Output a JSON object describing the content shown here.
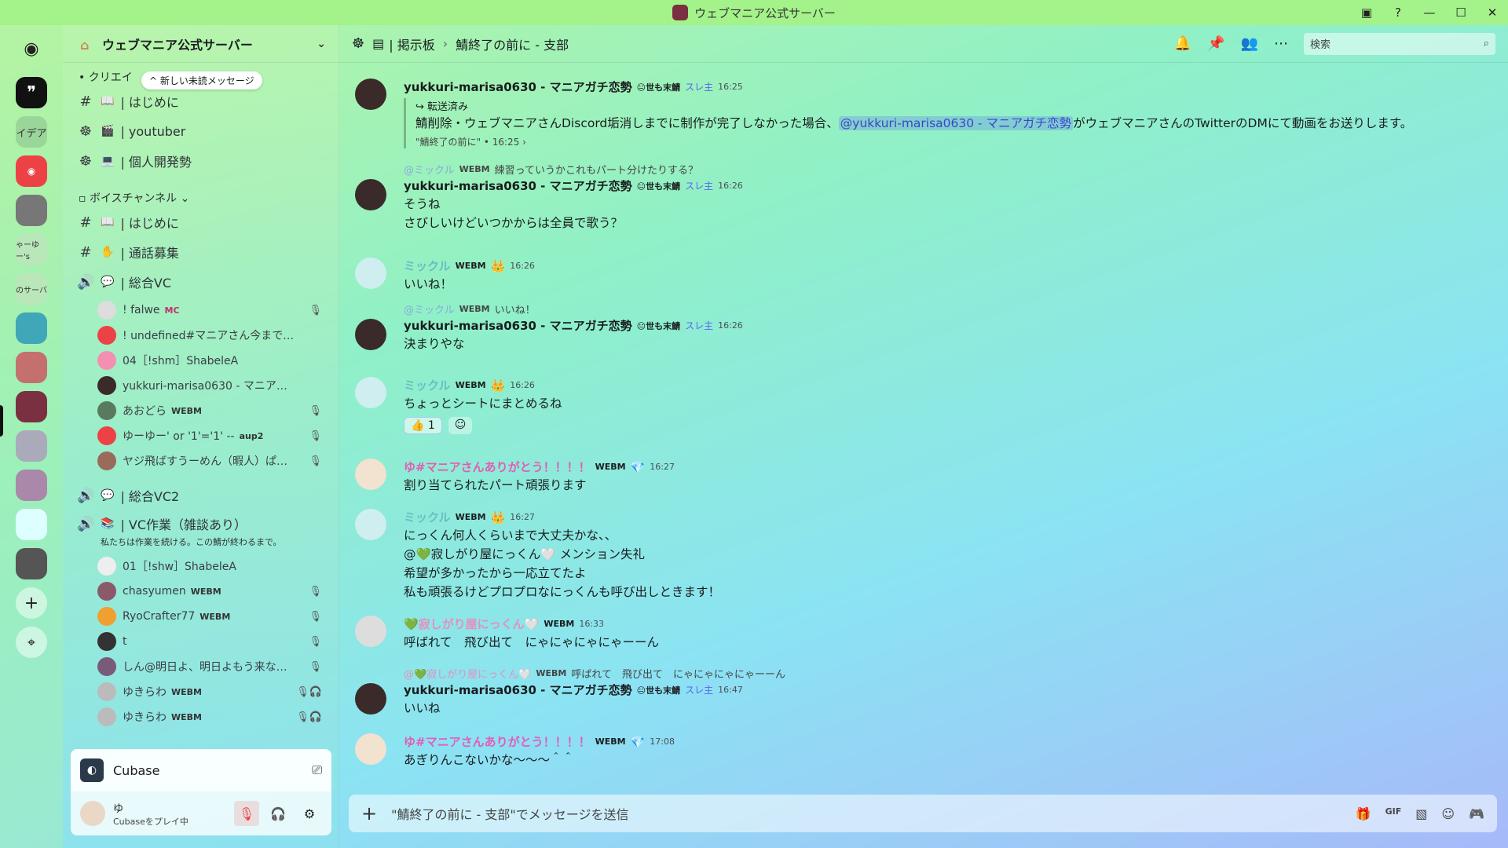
{
  "window": {
    "title": "ウェブマニア公式サーバー"
  },
  "rail": {
    "items": [
      "💬",
      "イデア",
      "Discord",
      "",
      "ゃーゆー's",
      "のサーバ",
      "",
      "",
      "",
      "",
      "",
      "",
      "",
      "+",
      "⌖"
    ]
  },
  "sidebar": {
    "guild_name": "ウェブマニア公式サーバー",
    "unread_pill": "新しい未読メッセージ",
    "category1": "クリエイ",
    "channels_top": [
      {
        "icon": "#",
        "emoji": "📖",
        "label": "| はじめに"
      },
      {
        "icon": "☸",
        "emoji": "🎬",
        "label": "| youtuber"
      },
      {
        "icon": "☸",
        "emoji": "💻",
        "label": "| 個人開発勢"
      }
    ],
    "voice_category": "ボイスチャンネル",
    "channels_voice": [
      {
        "icon": "#",
        "emoji": "📖",
        "label": "| はじめに"
      },
      {
        "icon": "#",
        "emoji": "✋",
        "label": "| 通話募集"
      },
      {
        "icon": "🔊",
        "emoji": "💬",
        "label": "| 総合VC"
      }
    ],
    "vc1_users": [
      {
        "name": "! falwe",
        "badge": "MC",
        "muted": "🎙",
        "color": "#ddd"
      },
      {
        "name": "! undefined#マニアさん今までありが…",
        "badge": "",
        "muted": "",
        "color": "#ed4245"
      },
      {
        "name": "04［!shm］ShabeleA",
        "badge": "",
        "muted": "",
        "color": "#f48fb1"
      },
      {
        "name": "yukkuri-marisa0630 - マニアガチ恋勢",
        "badge": "",
        "muted": "",
        "color": "#3a2a2a"
      },
      {
        "name": "あおどら",
        "badge": "WEBM",
        "muted": "🎙",
        "color": "#5a7a60"
      },
      {
        "name": "ゆーゆー' or '1'='1' --",
        "badge": "aup2",
        "muted": "🎙",
        "color": "#ed4245"
      },
      {
        "name": "ヤジ飛ばすうーめん（暇人）ぱけ…",
        "badge": "",
        "muted": "🎙",
        "color": "#9a6a5a"
      }
    ],
    "vc2": {
      "icon": "🔊",
      "emoji": "💬",
      "label": "| 総合VC2"
    },
    "vc3": {
      "icon": "🔊",
      "emoji": "📚",
      "label": "| VC作業（雑談あり）",
      "desc": "私たちは作業を続ける。この鯖が終わるまで。"
    },
    "vc3_users": [
      {
        "name": "01［!shw］ShabeleA",
        "badge": "",
        "muted": "",
        "color": "#ddd"
      },
      {
        "name": "chasyumen",
        "badge": "WEBM",
        "muted": "🎙",
        "color": "#8a5a6a"
      },
      {
        "name": "RyoCrafter77",
        "badge": "WEBM",
        "muted": "🎙",
        "color": "#f0a030"
      },
      {
        "name": "t",
        "badge": "",
        "muted": "🎙",
        "color": "#333"
      },
      {
        "name": "しん@明日よ、明日よもう来ない…",
        "badge": "",
        "muted": "🎙",
        "color": "#7a5a7a"
      },
      {
        "name": "ゆきらわ",
        "badge": "WEBM",
        "muted": "🎙🎧",
        "color": "#aaa"
      },
      {
        "name": "ゆきらわ",
        "badge": "WEBM",
        "muted": "🎙🎧",
        "color": "#aaa"
      }
    ],
    "activity": {
      "app": "Cubase"
    },
    "user": {
      "name": "ゆ",
      "status": "Cubaseをプレイ中"
    }
  },
  "header": {
    "channel": "| 掲示板",
    "thread": "鯖終了の前に - 支部",
    "search_placeholder": "検索"
  },
  "messages": [
    {
      "name": "yukkuri-marisa0630 - マニアガチ恋勢",
      "tag": "😐世も末鯖",
      "role": "スレ主",
      "time": "16:25",
      "color": "#1a1c1e",
      "forward": "転送済み",
      "lines": [
        "鯖削除・ウェブマニアさんDiscord垢消しまでに制作が完了しなかった場合、@yukkuri-marisa0630 - マニアガチ恋勢がウェブマニアさんのTwitterのDMにて動画をお送りします。"
      ],
      "footer": "\"鯖終了の前に\" • 16:25 ›"
    },
    {
      "reply_name": "@ミックル",
      "reply_tag": "WEBM",
      "reply_text": "練習っていうかこれもパート分けたりする？",
      "name": "yukkuri-marisa0630 - マニアガチ恋勢",
      "tag": "😐世も末鯖",
      "role": "スレ主",
      "time": "16:26",
      "color": "#1a1c1e",
      "lines": [
        "そうね",
        "さびしいけどいつかからは全員で歌う？"
      ]
    },
    {
      "name": "ミックル",
      "tag": "WEBM",
      "role": "👑",
      "time": "16:26",
      "color": "#7bc6cc",
      "lines": [
        "いいね！"
      ]
    },
    {
      "reply_name": "@ミックル",
      "reply_tag": "WEBM",
      "reply_text": "いいね！",
      "name": "yukkuri-marisa0630 - マニアガチ恋勢",
      "tag": "😐世も末鯖",
      "role": "スレ主",
      "time": "16:26",
      "color": "#1a1c1e",
      "lines": [
        "決まりやな"
      ]
    },
    {
      "name": "ミックル",
      "tag": "WEBM",
      "role": "👑",
      "time": "16:26",
      "color": "#7bc6cc",
      "lines": [
        "ちょっとシートにまとめるね"
      ],
      "reaction": "👍 1"
    },
    {
      "name": "ゆ#マニアさんありがとう！！！！",
      "tag": "WEBM",
      "role": "💎",
      "time": "16:27",
      "color": "#e35db5",
      "lines": [
        "割り当てられたパート頑張ります"
      ]
    },
    {
      "name": "ミックル",
      "tag": "WEBM",
      "role": "👑",
      "time": "16:27",
      "color": "#7bc6cc",
      "lines": [
        "にっくん何人くらいまで大丈夫かな、、",
        "@💚寂しがり屋にっくん🤍 メンション失礼",
        "希望が多かったから一応立てたよ",
        "私も頑張るけどプロプロなにっくんも呼び出しときます！"
      ]
    },
    {
      "name": "💚寂しがり屋にっくん🤍",
      "tag": "WEBM",
      "role": "",
      "time": "16:33",
      "color": "#e58fbf",
      "lines": [
        "呼ばれて　飛び出て　にゃにゃにゃにゃーーん"
      ]
    },
    {
      "reply_name": "@💚寂しがり屋にっくん🤍",
      "reply_tag": "WEBM",
      "reply_text": "呼ばれて　飛び出て　にゃにゃにゃにゃーーん",
      "name": "yukkuri-marisa0630 - マニアガチ恋勢",
      "tag": "😐世も末鯖",
      "role": "スレ主",
      "time": "16:47",
      "color": "#1a1c1e",
      "lines": [
        "いいね"
      ]
    },
    {
      "name": "ゆ#マニアさんありがとう！！！！",
      "tag": "WEBM",
      "role": "💎",
      "time": "17:08",
      "color": "#e35db5",
      "lines": [
        "あぎりんこないかな〜〜〜＾＾"
      ]
    }
  ],
  "composer": {
    "placeholder": "\"鯖終了の前に - 支部\"でメッセージを送信"
  }
}
